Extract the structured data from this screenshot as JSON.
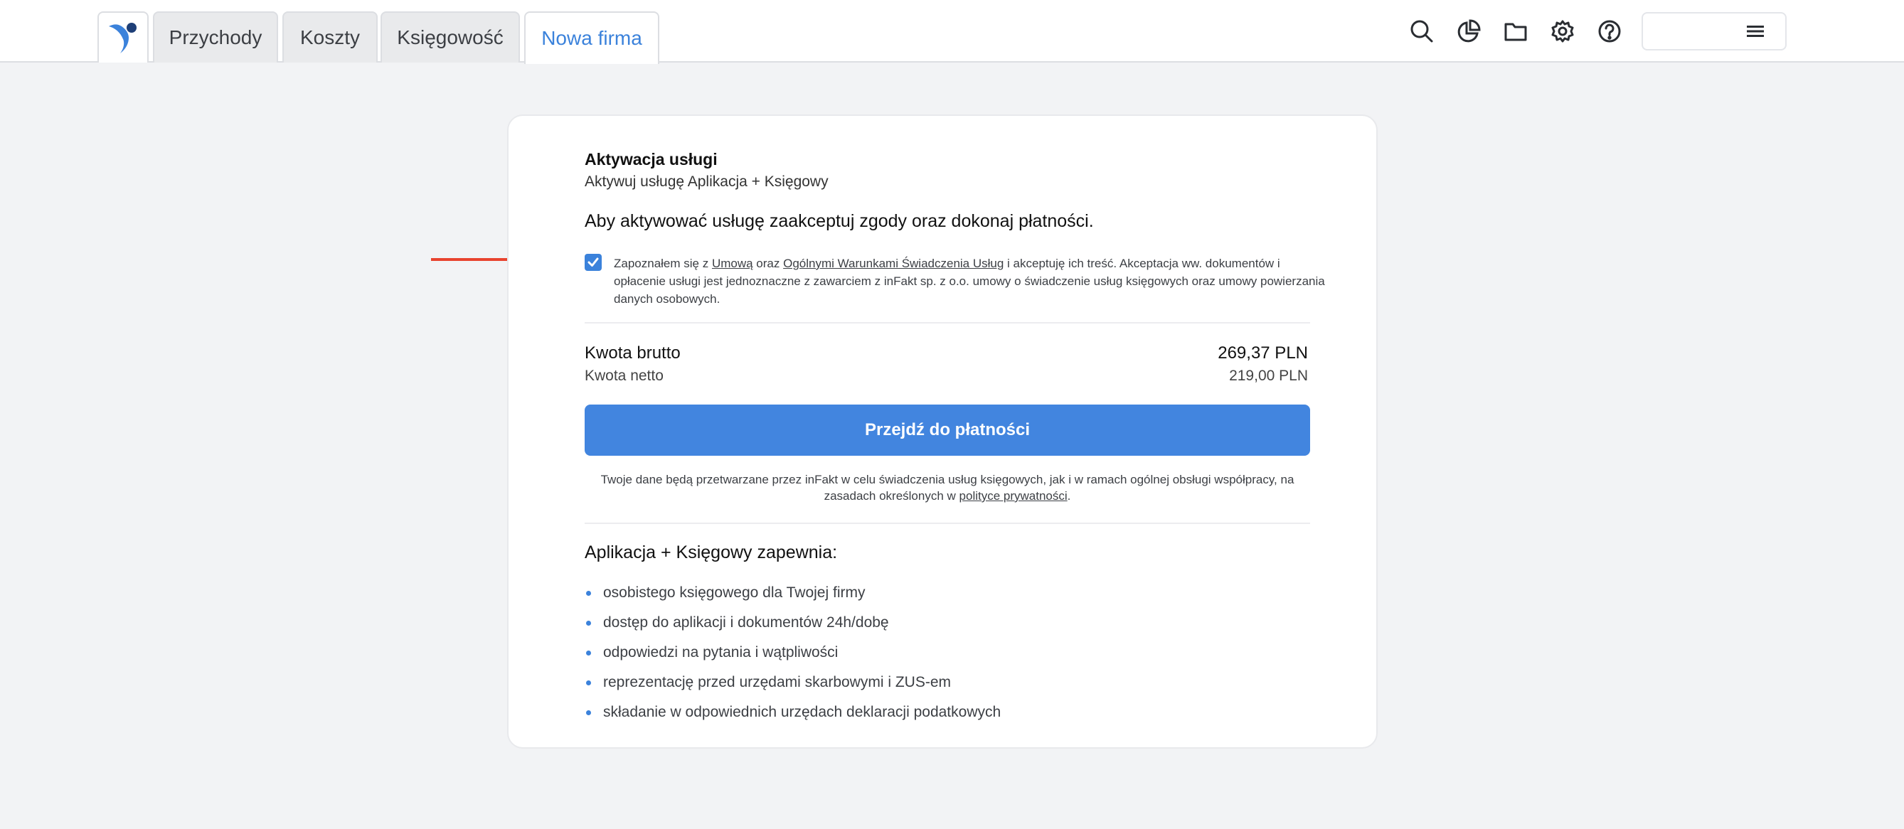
{
  "header": {
    "logo_icon": "infakt-bird-logo-icon",
    "tabs": [
      {
        "label": "Przychody"
      },
      {
        "label": "Koszty"
      },
      {
        "label": "Księgowość"
      },
      {
        "label": "Nowa firma",
        "active": true
      }
    ],
    "icons": [
      "search-icon",
      "reports-chart-icon",
      "folder-icon",
      "gear-icon",
      "help-icon"
    ],
    "account_menu_icon": "hamburger-menu-icon"
  },
  "activation": {
    "title": "Aktywacja usługi",
    "subtitle": "Aktywuj usługę Aplikacja + Księgowy",
    "lead": "Aby aktywować usługę zaakceptuj zgody oraz dokonaj płatności.",
    "consent": {
      "checked": true,
      "text_1": "Zapoznałem się z ",
      "link_1": "Umową",
      "text_2": " oraz ",
      "link_2": "Ogólnymi Warunkami Świadczenia Usług",
      "text_3": " i akceptuję ich treść. Akceptacja ww. dokumentów i opłacenie usługi jest jednoznaczne z zawarciem z inFakt sp. z o.o. umowy o świadczenie usług księgowych oraz umowy powierzania danych osobowych."
    },
    "gross_label": "Kwota brutto",
    "gross_value": "269,37 PLN",
    "net_label": "Kwota netto",
    "net_value": "219,00 PLN",
    "pay_button": "Przejdź do płatności",
    "privacy_text": "Twoje dane będą przetwarzane przez inFakt w celu świadczenia usług księgowych, jak i w ramach ogólnej obsługi współpracy, na zasadach określonych w ",
    "privacy_link": "polityce prywatności",
    "privacy_end": ".",
    "features_title": "Aplikacja + Księgowy zapewnia:",
    "features": [
      "osobistego księgowego dla Twojej firmy",
      "dostęp do aplikacji i dokumentów 24h/dobę",
      "odpowiedzi na pytania i wątpliwości",
      "reprezentację przed urzędami skarbowymi i ZUS-em",
      "składanie w odpowiednich urzędach deklaracji podatkowych"
    ]
  },
  "colors": {
    "accent": "#3b82db",
    "button": "#4285df",
    "annotation_arrow": "#e8432e"
  }
}
